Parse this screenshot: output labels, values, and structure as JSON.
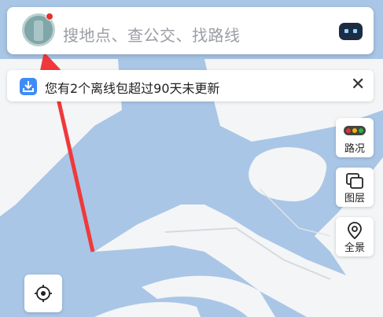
{
  "search": {
    "placeholder": "搜地点、查公交、找路线"
  },
  "notice": {
    "text": "您有2个离线包超过90天未更新",
    "close_glyph": "✕"
  },
  "side_controls": {
    "traffic_label": "路况",
    "layers_label": "图层",
    "overview_label": "全景"
  },
  "colors": {
    "water": "#a9c6e6",
    "land": "#f4f5f7",
    "annotation_arrow": "#f0393a",
    "accent_blue": "#3f8cf6"
  },
  "icons": {
    "avatar": "avatar",
    "assistant": "robot-icon",
    "download": "download-icon",
    "close": "close-icon",
    "traffic": "traffic-light-icon",
    "layers": "layers-icon",
    "overview": "location-pin-icon",
    "locate": "locate-icon"
  }
}
